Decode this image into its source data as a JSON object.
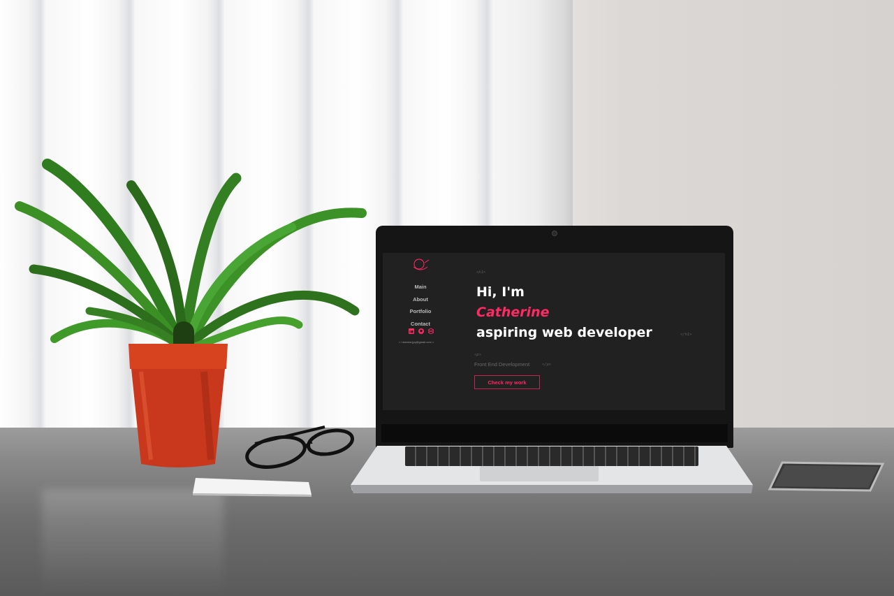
{
  "nav": {
    "items": [
      {
        "label": "Main"
      },
      {
        "label": "About"
      },
      {
        "label": "Portfolio"
      },
      {
        "label": "Contact"
      }
    ]
  },
  "social": {
    "icons": [
      "linkedin-icon",
      "github-icon",
      "codepen-icon"
    ],
    "email": "< l daenior.jpy@gmail.com >"
  },
  "hero": {
    "open_tag": "<h1>",
    "close_tag": "</h1>",
    "greeting": "Hi, I'm",
    "name": "Catherine",
    "role": "aspiring web developer"
  },
  "subtitle": {
    "open_tag": "<p>",
    "text": "Front End Development",
    "close_tag": "</p>"
  },
  "cta": {
    "label": "Check my work"
  },
  "colors": {
    "accent": "#ff2a64",
    "screen_background": "#212121",
    "text_primary": "#ffffff",
    "nav_text": "#bcbcbc"
  }
}
